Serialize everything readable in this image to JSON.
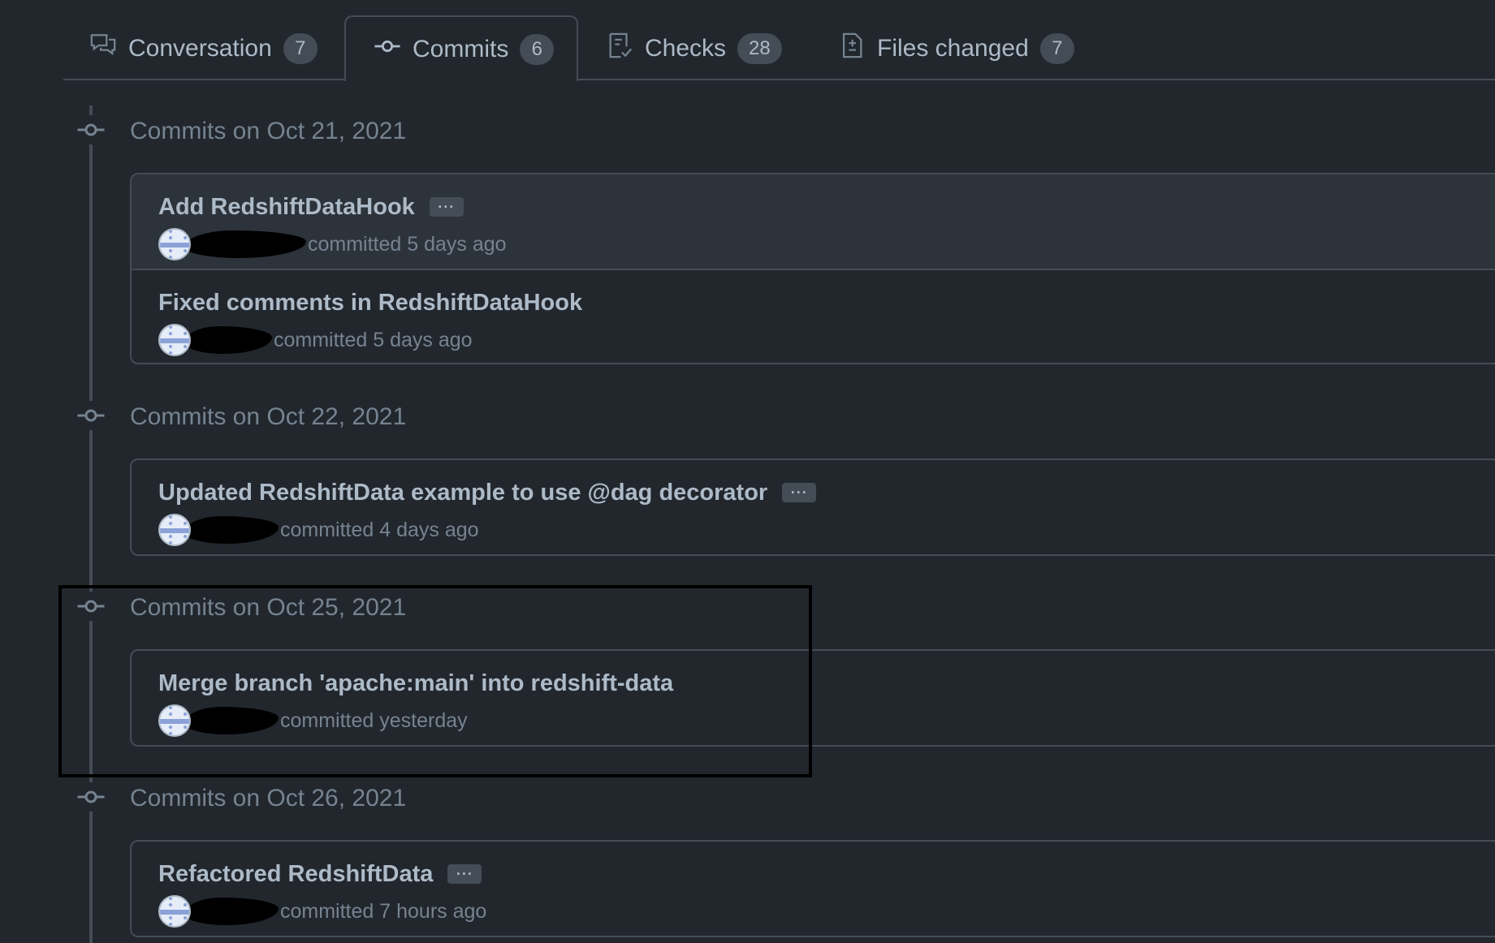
{
  "tabs": [
    {
      "label": "Conversation",
      "count": "7",
      "icon": "comment-discussion-icon"
    },
    {
      "label": "Commits",
      "count": "6",
      "icon": "git-commit-icon"
    },
    {
      "label": "Checks",
      "count": "28",
      "icon": "checklist-icon"
    },
    {
      "label": "Files changed",
      "count": "7",
      "icon": "file-diff-icon"
    }
  ],
  "groups": [
    {
      "title": "Commits on Oct 21, 2021",
      "commits": [
        {
          "title": "Add RedshiftDataHook",
          "has_ellipsis": true,
          "ellipsis": "···",
          "meta": "committed 5 days ago"
        },
        {
          "title": "Fixed comments in RedshiftDataHook",
          "has_ellipsis": false,
          "meta": "committed 5 days ago"
        }
      ]
    },
    {
      "title": "Commits on Oct 22, 2021",
      "commits": [
        {
          "title": "Updated RedshiftData example to use @dag decorator",
          "has_ellipsis": true,
          "ellipsis": "···",
          "meta": "committed 4 days ago"
        }
      ]
    },
    {
      "title": "Commits on Oct 25, 2021",
      "commits": [
        {
          "title": "Merge branch 'apache:main' into redshift-data",
          "has_ellipsis": false,
          "meta": "committed yesterday"
        }
      ]
    },
    {
      "title": "Commits on Oct 26, 2021",
      "commits": [
        {
          "title": "Refactored RedshiftData",
          "has_ellipsis": true,
          "ellipsis": "···",
          "meta": "committed 7 hours ago"
        }
      ]
    }
  ],
  "colors": {
    "background": "#22272e",
    "border": "#444c56",
    "text": "#adbac7",
    "muted": "#768390"
  }
}
